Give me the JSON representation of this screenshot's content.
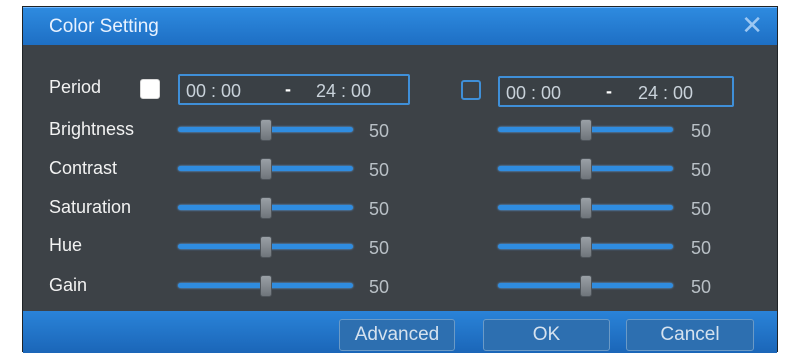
{
  "dialog": {
    "title": "Color Setting",
    "close_glyph": "✕"
  },
  "period": {
    "label": "Period",
    "left": {
      "enabled": true,
      "start": "00 : 00",
      "end": "24 : 00",
      "separator": "-"
    },
    "right": {
      "enabled": false,
      "start": "00 : 00",
      "end": "24 : 00",
      "separator": "-"
    }
  },
  "settings": [
    {
      "label": "Brightness",
      "left_value": "50",
      "right_value": "50"
    },
    {
      "label": "Contrast",
      "left_value": "50",
      "right_value": "50"
    },
    {
      "label": "Saturation",
      "left_value": "50",
      "right_value": "50"
    },
    {
      "label": "Hue",
      "left_value": "50",
      "right_value": "50"
    },
    {
      "label": "Gain",
      "left_value": "50",
      "right_value": "50"
    }
  ],
  "slider_range": [
    0,
    100
  ],
  "buttons": {
    "advanced": "Advanced",
    "ok": "OK",
    "cancel": "Cancel"
  },
  "icons": {
    "close": "close-icon"
  },
  "colors": {
    "accent": "#2f8ce0",
    "panel": "#3d4247",
    "titlebar": "#1e6fc4"
  }
}
